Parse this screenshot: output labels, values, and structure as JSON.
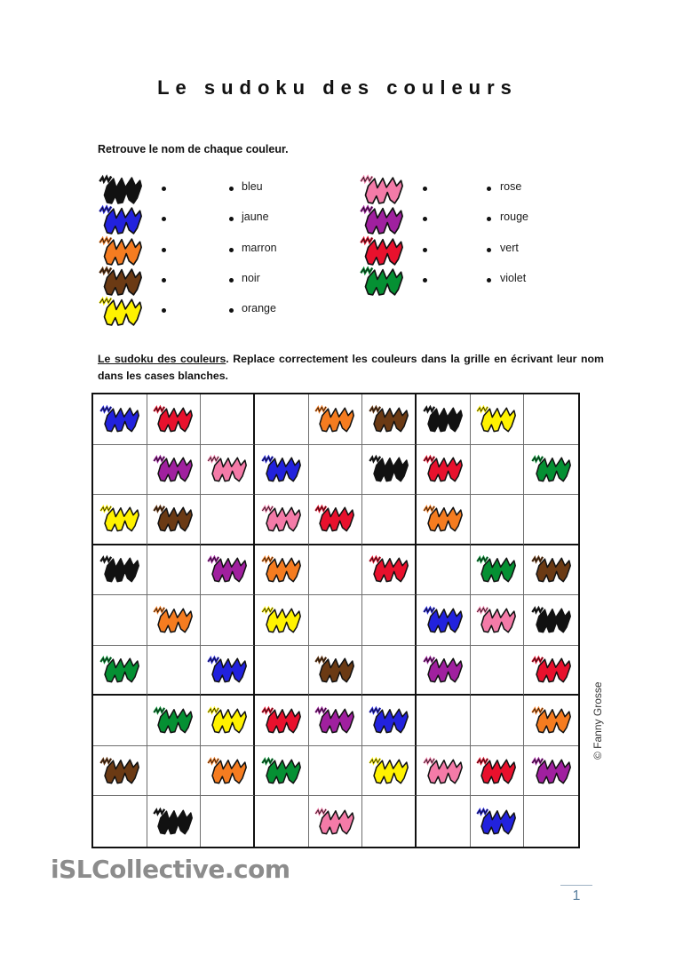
{
  "document": {
    "title": "Le sudoku des couleurs",
    "watermark": "iSLCollective.com",
    "copyright": "© Fanny Grosse",
    "page_number": "1"
  },
  "exercise1": {
    "instruction": "Retrouve le nom de chaque couleur.",
    "left_group": {
      "swatch_colors": [
        "black",
        "blue",
        "orange",
        "brown",
        "yellow"
      ],
      "words": [
        "bleu",
        "jaune",
        "marron",
        "noir",
        "orange"
      ]
    },
    "right_group": {
      "swatch_colors": [
        "pink",
        "purple",
        "red",
        "green"
      ],
      "words": [
        "rose",
        "rouge",
        "vert",
        "violet"
      ]
    }
  },
  "exercise2": {
    "instruction_underlined": "Le sudoku des couleurs",
    "instruction_rest": ". Replace correctement les couleurs dans la grille en écrivant leur nom dans les cases blanches."
  },
  "palette": {
    "black": "#111111",
    "blue": "#2222dd",
    "orange": "#f57c20",
    "brown": "#6b3a14",
    "yellow": "#fff200",
    "pink": "#f47ba8",
    "purple": "#a0209f",
    "red": "#e8112d",
    "green": "#059033",
    "empty": null
  },
  "grid": {
    "rows": 9,
    "cols": 9,
    "cells": [
      [
        "blue",
        "red",
        null,
        null,
        "orange",
        "brown",
        "black",
        "yellow",
        null
      ],
      [
        null,
        "purple",
        "pink",
        "blue",
        null,
        "black",
        "red",
        null,
        "green"
      ],
      [
        "yellow",
        "brown",
        null,
        "pink",
        "red",
        null,
        "orange",
        null,
        null
      ],
      [
        "black",
        null,
        "purple",
        "orange",
        null,
        "red",
        null,
        "green",
        "brown"
      ],
      [
        null,
        "orange",
        null,
        "yellow",
        null,
        null,
        "blue",
        "pink",
        "black"
      ],
      [
        "green",
        null,
        "blue",
        null,
        "brown",
        null,
        "purple",
        null,
        "red"
      ],
      [
        null,
        "green",
        "yellow",
        "red",
        "purple",
        "blue",
        null,
        null,
        "orange"
      ],
      [
        "brown",
        null,
        "orange",
        "green",
        null,
        "yellow",
        "pink",
        "red",
        "purple"
      ],
      [
        null,
        "black",
        null,
        null,
        "pink",
        null,
        null,
        "blue",
        null
      ]
    ]
  }
}
